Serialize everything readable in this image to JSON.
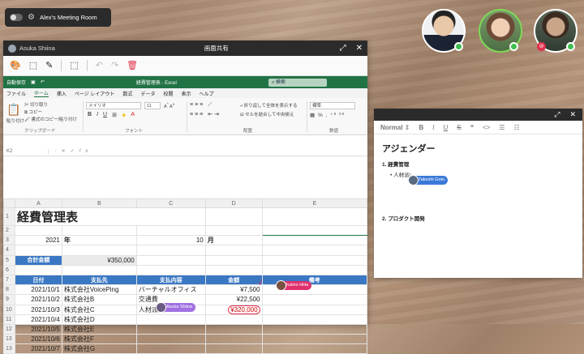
{
  "room": {
    "name": "Alex's Meeting Room"
  },
  "share": {
    "user": "Asuka Shiina",
    "title": "画面共有"
  },
  "excel": {
    "autosave": "自動保存",
    "filename": "経費管理表 - Excel",
    "search": "検索",
    "menu": [
      "ファイル",
      "ホーム",
      "挿入",
      "ページ レイアウト",
      "数式",
      "データ",
      "校閲",
      "表示",
      "ヘルプ"
    ],
    "ribbon": {
      "cut": "切り取り",
      "copy": "コピー",
      "painter": "書式のコピー/貼り付け",
      "paste": "貼り付け",
      "font_name": "メイリオ",
      "font_size": "11",
      "wrap": "折り返して全体を表示する",
      "merge": "セルを結合して中央揃え",
      "numfmt": "標準",
      "g_clip": "クリップボード",
      "g_font": "フォント",
      "g_align": "配置",
      "g_num": "数値"
    },
    "namebox": "K2",
    "cols": [
      "A",
      "B",
      "C",
      "D",
      "E"
    ],
    "title": "経費管理表",
    "year": "2021",
    "year_unit": "年",
    "month": "10",
    "month_unit": "月",
    "total_label": "合計金額",
    "total": "¥350,000",
    "headers": [
      "日付",
      "支払先",
      "支払内容",
      "金額",
      "備考"
    ],
    "rows": [
      [
        "2021/10/1",
        "株式会社VoicePing",
        "バーチャルオフィス",
        "¥7,500",
        ""
      ],
      [
        "2021/10/2",
        "株式会社B",
        "交通費",
        "¥22,500",
        ""
      ],
      [
        "2021/10/3",
        "株式会社C",
        "人材派遣",
        "¥320,000",
        ""
      ],
      [
        "2021/10/4",
        "株式会社D",
        "",
        "",
        ""
      ],
      [
        "2021/10/5",
        "株式会社E",
        "",
        "",
        ""
      ],
      [
        "2021/10/6",
        "株式会社F",
        "",
        "",
        ""
      ],
      [
        "2021/10/7",
        "株式会社G",
        "",
        "",
        ""
      ]
    ],
    "row_numbers": [
      "1",
      "2",
      "3",
      "4",
      "5",
      "6",
      "7",
      "8",
      "9",
      "10",
      "11",
      "12",
      "13"
    ]
  },
  "cursors": {
    "asuka": "Asuka Shiina",
    "fukino": "fukino Hiita",
    "takeshi": "Takeshi Goto"
  },
  "agenda": {
    "style": "Normal",
    "title": "アジェンダー",
    "item1": "1. 経費管理",
    "sub1": "人材派",
    "item2": "2. プロダクト開発"
  },
  "colors": {
    "excel_green": "#217346",
    "header_blue": "#3a78c4",
    "mic_muted": "#e0304c",
    "online": "#3fbf4f"
  }
}
